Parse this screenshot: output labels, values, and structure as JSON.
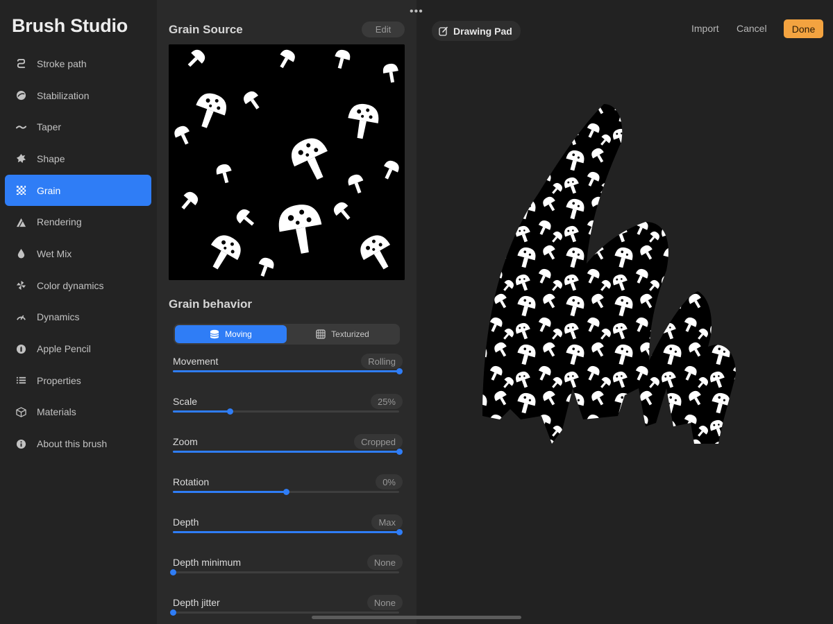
{
  "app": {
    "title": "Brush Studio"
  },
  "sidebar": {
    "items": [
      {
        "label": "Stroke path",
        "icon": "stroke-path-icon"
      },
      {
        "label": "Stabilization",
        "icon": "stabilization-icon"
      },
      {
        "label": "Taper",
        "icon": "taper-icon"
      },
      {
        "label": "Shape",
        "icon": "shape-icon"
      },
      {
        "label": "Grain",
        "icon": "grain-icon",
        "active": true
      },
      {
        "label": "Rendering",
        "icon": "rendering-icon"
      },
      {
        "label": "Wet Mix",
        "icon": "wet-mix-icon"
      },
      {
        "label": "Color dynamics",
        "icon": "color-dynamics-icon"
      },
      {
        "label": "Dynamics",
        "icon": "dynamics-icon"
      },
      {
        "label": "Apple Pencil",
        "icon": "apple-pencil-icon"
      },
      {
        "label": "Properties",
        "icon": "properties-icon"
      },
      {
        "label": "Materials",
        "icon": "materials-icon"
      },
      {
        "label": "About this brush",
        "icon": "info-icon"
      }
    ]
  },
  "grain_source": {
    "title": "Grain Source",
    "edit_label": "Edit"
  },
  "grain_behavior": {
    "title": "Grain behavior",
    "modes": [
      {
        "label": "Moving",
        "icon": "moving-icon",
        "selected": true
      },
      {
        "label": "Texturized",
        "icon": "texturized-icon",
        "selected": false
      }
    ],
    "params": [
      {
        "label": "Movement",
        "value": "Rolling",
        "level": 1.0
      },
      {
        "label": "Scale",
        "value": "25%",
        "level": 0.25
      },
      {
        "label": "Zoom",
        "value": "Cropped",
        "level": 1.0
      },
      {
        "label": "Rotation",
        "value": "0%",
        "level": 0.5
      },
      {
        "label": "Depth",
        "value": "Max",
        "level": 1.0
      },
      {
        "label": "Depth minimum",
        "value": "None",
        "level": 0.0
      },
      {
        "label": "Depth jitter",
        "value": "None",
        "level": 0.0
      }
    ]
  },
  "drawing_pad": {
    "tab_label": "Drawing Pad",
    "import_label": "Import",
    "cancel_label": "Cancel",
    "done_label": "Done"
  },
  "colors": {
    "accent": "#2f7df6",
    "done": "#f3a340",
    "background": "#1e1e1e"
  }
}
